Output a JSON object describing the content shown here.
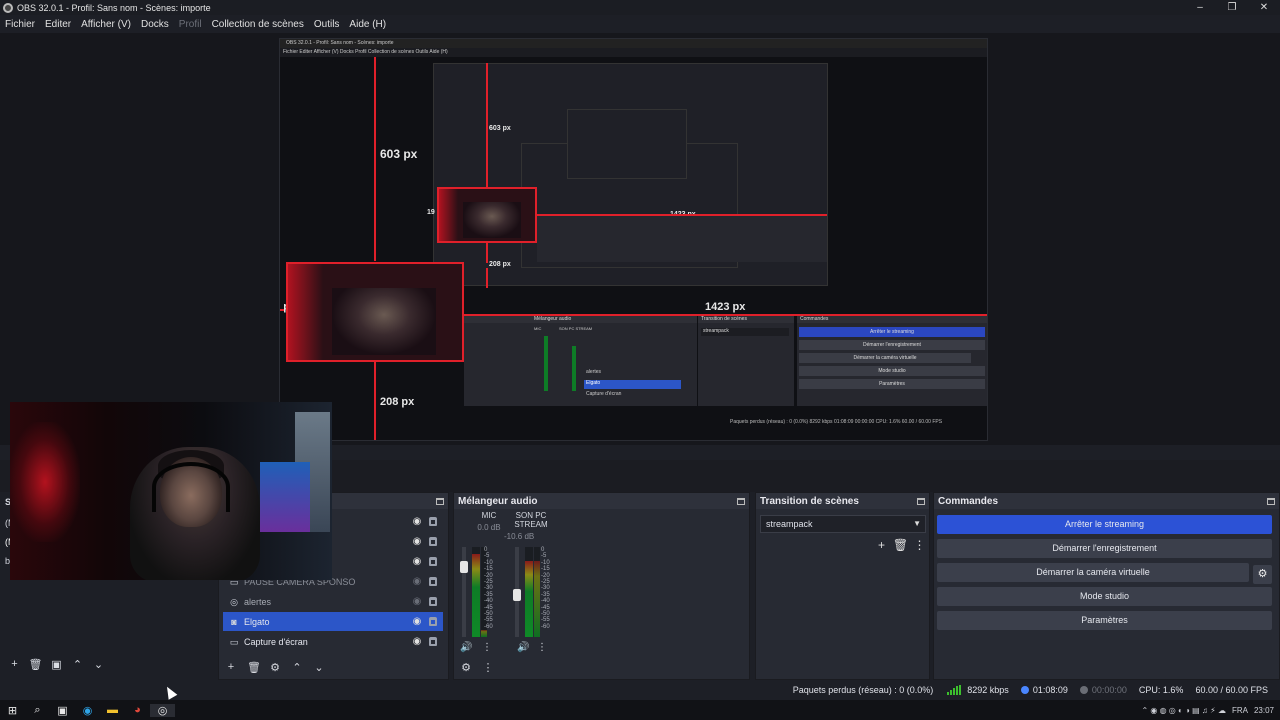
{
  "window": {
    "title": "OBS 32.0.1 - Profil: Sans nom - Scènes: importe",
    "controls": [
      "–",
      "❐",
      "✕"
    ]
  },
  "menu": {
    "items": [
      "Fichier",
      "Editer",
      "Afficher (V)",
      "Docks",
      "Profil",
      "Collection de scènes",
      "Outils",
      "Aide (H)"
    ]
  },
  "preview": {
    "inner_title": "OBS 32.0.1 - Profil: Sans nom - Scènes: importe",
    "inner_menu": "Fichier   Editer   Afficher (V)   Docks   Profil   Collection de scènes   Outils   Aide (H)",
    "measures": {
      "top_outer": "603 px",
      "top_inner": "603 px",
      "left_outer": "19 px",
      "left_inner": "19 px",
      "right_outer": "1423 px",
      "right_inner": "1423 px",
      "bottom_outer": "208 px",
      "bottom_inner": "208 px"
    },
    "mini_panels": {
      "mixer": "Mélangeur audio",
      "transition": "Transition de scènes",
      "commands": "Commandes",
      "mic": "MIC",
      "son": "SON PC STREAM",
      "streampack": "streampack",
      "btn1": "Arrêter le streaming",
      "btn2": "Démarrer l'enregistrement",
      "btn3": "Démarrer la caméra virtuelle",
      "btn4": "Mode studio",
      "btn5": "Paramètres",
      "src1": "alertes",
      "src2": "Elgato",
      "src3": "Capture d'écran",
      "status": "Paquets perdus (réseau) : 0 (0.0%)     8292 kbps     01:08:09     00:00:00     CPU: 1.6%     60.00 / 60.00 FPS"
    }
  },
  "left_dock": {
    "fragments": [
      "Sc",
      "(M",
      "(M",
      "b"
    ],
    "tools": [
      "+",
      "🗑",
      "▣",
      "⌃",
      "⌄"
    ]
  },
  "sources": {
    "title": "",
    "partial_label": "PAUSE CAMERA SPONSO",
    "rows": [
      {
        "label": "",
        "icon": "●",
        "visible": true
      },
      {
        "label": "",
        "icon": "●",
        "visible": true
      },
      {
        "label": "",
        "icon": "●",
        "visible": true
      },
      {
        "label": "PAUSE CAMERA SPONSO",
        "icon": "▭",
        "visible": false
      },
      {
        "label": "alertes",
        "icon": "◎",
        "visible": false
      },
      {
        "label": "Elgato",
        "icon": "📷",
        "visible": true,
        "selected": true
      },
      {
        "label": "Capture d'écran",
        "icon": "▭",
        "visible": true
      }
    ],
    "tools": [
      "+",
      "🗑",
      "⚙",
      "⌃",
      "⌄"
    ]
  },
  "mixer": {
    "title": "Mélangeur audio",
    "channels": [
      {
        "name": "MIC",
        "db": "0.0 dB"
      },
      {
        "name": "SON PC STREAM",
        "db": "-10.6 dB"
      }
    ],
    "ticks": [
      "0",
      "-5",
      "-10",
      "-15",
      "-20",
      "-25",
      "-30",
      "-35",
      "-40",
      "-45",
      "-50",
      "-55",
      "-60"
    ],
    "tools": [
      "⚙",
      "⋮"
    ]
  },
  "transition": {
    "title": "Transition de scènes",
    "selected": "streampack",
    "icons": [
      "+",
      "🗑",
      "⋮"
    ]
  },
  "commands": {
    "title": "Commandes",
    "buttons": [
      "Arrêter le streaming",
      "Démarrer l'enregistrement",
      "Démarrer la caméra virtuelle",
      "Mode studio",
      "Paramètres"
    ]
  },
  "status": {
    "dropped": "Paquets perdus (réseau) : 0 (0.0%)",
    "bitrate": "8292 kbps",
    "live_time": "01:08:09",
    "rec_time": "00:00:00",
    "cpu": "CPU: 1.6%",
    "fps": "60.00 / 60.00 FPS"
  },
  "taskbar": {
    "lang": "FRA",
    "time": "23:07"
  },
  "colors": {
    "accent_blue": "#2c52d6",
    "selection_blue": "#2c56c8",
    "measure_red": "#e0202a"
  }
}
